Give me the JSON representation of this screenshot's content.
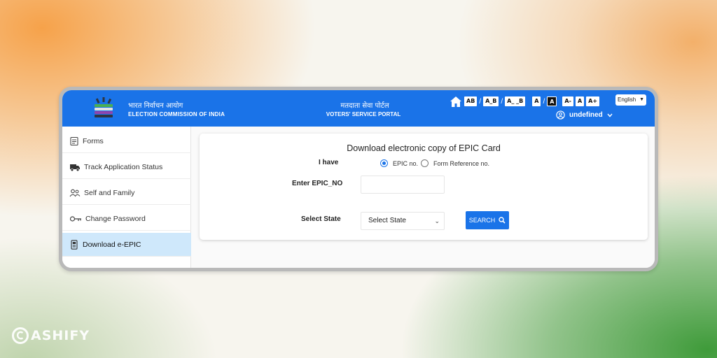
{
  "header": {
    "eci_hindi": "भारत निर्वाचन आयोग",
    "eci_english": "ELECTION COMMISSION OF INDIA",
    "portal_hindi": "मतदाता सेवा पोर्टल",
    "portal_english": "VOTERS' SERVICE PORTAL",
    "toolbar": {
      "contrast_1": "AB",
      "sep": "/",
      "contrast_2": "A_B",
      "contrast_3": "A_ _B",
      "font_normal": "A",
      "font_dark": "A",
      "font_small": "A-",
      "font_default": "A",
      "font_large": "A+"
    },
    "language": "English",
    "user_name": "undefined"
  },
  "sidebar": {
    "items": [
      {
        "label": "Forms",
        "icon": "forms-icon"
      },
      {
        "label": "Track Application Status",
        "icon": "truck-icon"
      },
      {
        "label": "Self and Family",
        "icon": "family-icon"
      },
      {
        "label": "Change Password",
        "icon": "key-icon"
      },
      {
        "label": "Download e-EPIC",
        "icon": "phone-card-icon",
        "active": true
      }
    ]
  },
  "form": {
    "title": "Download electronic copy of EPIC Card",
    "i_have_label": "I have",
    "radio_epic": "EPIC no.",
    "radio_form_ref": "Form Reference no.",
    "epic_label": "Enter EPIC_NO",
    "epic_value": "",
    "state_label": "Select State",
    "state_selected": "Select State",
    "search_button": "SEARCH"
  },
  "watermark": {
    "brand": "ASHIFY"
  },
  "colors": {
    "primary": "#1a73e8",
    "active_sidebar": "#cfe8fb"
  }
}
